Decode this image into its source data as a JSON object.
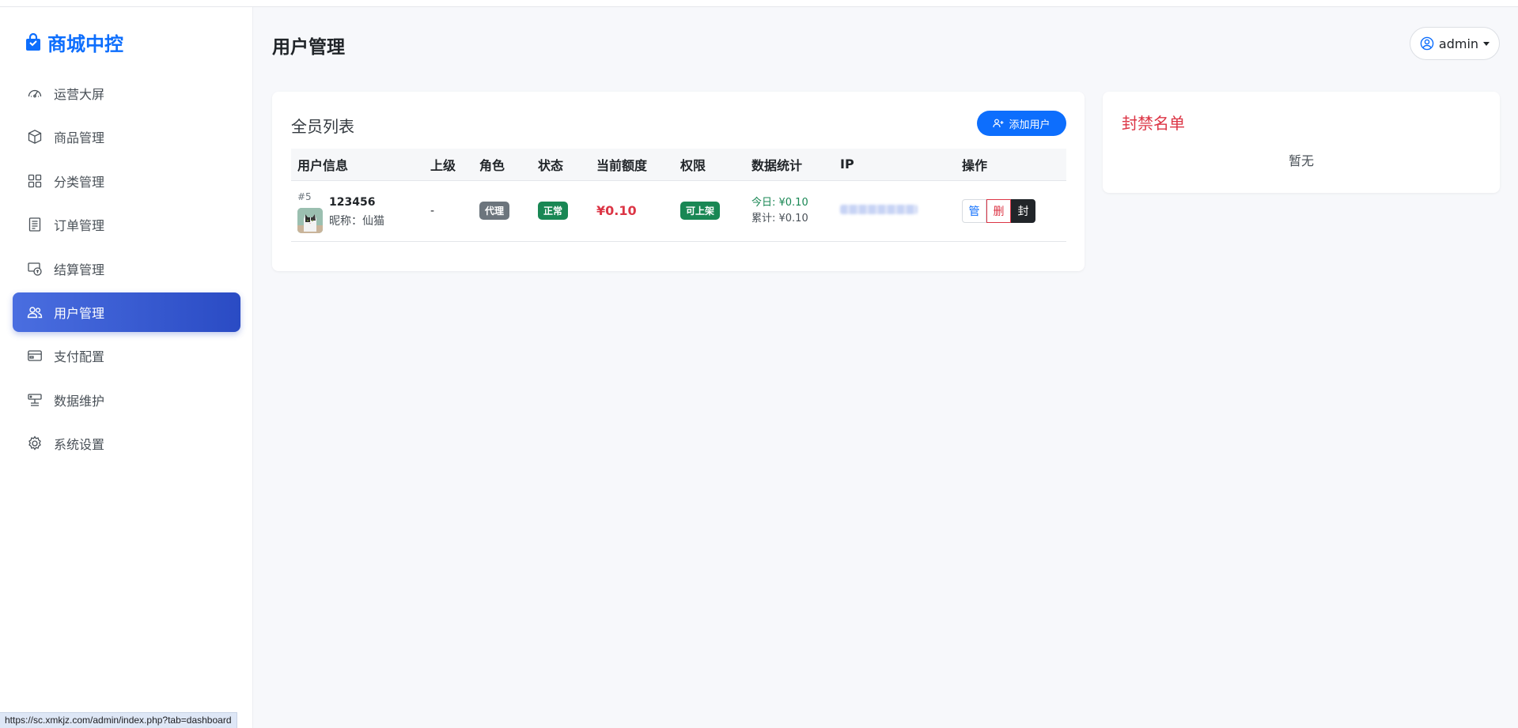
{
  "brand": {
    "title": "商城中控"
  },
  "sidebar": {
    "items": [
      {
        "label": "运营大屏",
        "icon": "speedometer-icon",
        "active": false
      },
      {
        "label": "商品管理",
        "icon": "box-icon",
        "active": false
      },
      {
        "label": "分类管理",
        "icon": "grid-icon",
        "active": false
      },
      {
        "label": "订单管理",
        "icon": "receipt-icon",
        "active": false
      },
      {
        "label": "结算管理",
        "icon": "cash-coin-icon",
        "active": false
      },
      {
        "label": "用户管理",
        "icon": "people-icon",
        "active": true
      },
      {
        "label": "支付配置",
        "icon": "credit-card-icon",
        "active": false
      },
      {
        "label": "数据维护",
        "icon": "server-icon",
        "active": false
      },
      {
        "label": "系统设置",
        "icon": "gear-icon",
        "active": false
      }
    ]
  },
  "header": {
    "title": "用户管理",
    "user_menu": {
      "label": "admin",
      "icon": "person-circle-icon"
    }
  },
  "user_list": {
    "title": "全员列表",
    "add_button_label": "添加用户",
    "columns": [
      "用户信息",
      "上级",
      "角色",
      "状态",
      "当前额度",
      "权限",
      "数据统计",
      "IP",
      "操作"
    ],
    "rows": [
      {
        "id": "#5",
        "username": "123456",
        "nickname": "昵称：仙猫",
        "parent": "-",
        "role": "代理",
        "status": "正常",
        "balance": "¥0.10",
        "permission": "可上架",
        "stat_today": "今日: ¥0.10",
        "stat_total": "累计: ¥0.10",
        "actions": {
          "manage": "管",
          "delete": "删",
          "ban": "封"
        }
      }
    ]
  },
  "blacklist": {
    "title": "封禁名单",
    "empty_text": "暂无"
  },
  "status_bar": {
    "url": "https://sc.xmkjz.com/admin/index.php?tab=dashboard"
  },
  "colors": {
    "primary": "#0d6efd",
    "active_nav_start": "#4a6ee0",
    "active_nav_end": "#2a4bc4",
    "danger": "#dc3545",
    "success": "#198754",
    "secondary": "#6c757d",
    "dark": "#212529"
  }
}
